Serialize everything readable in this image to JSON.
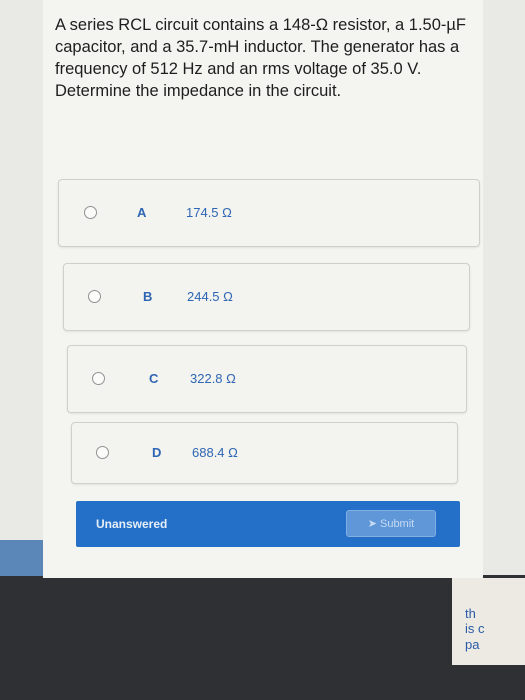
{
  "question": {
    "text": "A series RCL circuit contains a 148-Ω resistor, a 1.50-µF capacitor, and a 35.7-mH inductor. The generator has a frequency of 512 Hz and an rms voltage of 35.0 V. Determine the impedance in the circuit."
  },
  "options": [
    {
      "letter": "A",
      "value": "174.5 Ω"
    },
    {
      "letter": "B",
      "value": "244.5 Ω"
    },
    {
      "letter": "C",
      "value": "322.8 Ω"
    },
    {
      "letter": "D",
      "value": "688.4 Ω"
    }
  ],
  "status": {
    "label": "Unanswered",
    "submit_label": "Submit",
    "submit_icon": "send-icon"
  },
  "colors": {
    "accent": "#2470c9",
    "option_text": "#2f66b3",
    "submit_bg": "#5f97d8"
  },
  "side_peek": {
    "lines": [
      "th",
      "is c",
      "pa"
    ]
  }
}
